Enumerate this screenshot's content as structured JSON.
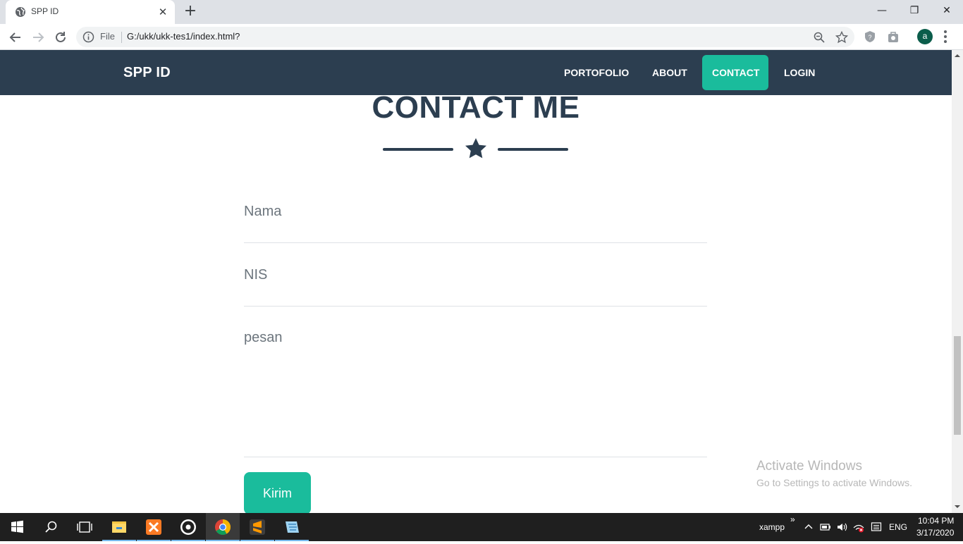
{
  "browser": {
    "tab_title": "SPP ID",
    "tab_close": "✕",
    "new_tab": "+",
    "window_controls": {
      "minimize": "—",
      "restore": "❐",
      "close": "✕"
    },
    "file_label": "File",
    "url": "G:/ukk/ukk-tes1/index.html?",
    "profile_initial": "a"
  },
  "site": {
    "brand": "SPP ID",
    "nav": [
      {
        "label": "PORTOFOLIO",
        "active": false
      },
      {
        "label": "ABOUT",
        "active": false
      },
      {
        "label": "CONTACT",
        "active": true
      },
      {
        "label": "LOGIN",
        "active": false
      }
    ],
    "heading": "CONTACT ME",
    "form": {
      "name_placeholder": "Nama",
      "nis_placeholder": "NIS",
      "message_placeholder": "pesan",
      "submit_label": "Kirim"
    },
    "colors": {
      "primary": "#2c3e50",
      "accent": "#1abc9c"
    }
  },
  "watermark": {
    "title": "Activate Windows",
    "subtitle": "Go to Settings to activate Windows."
  },
  "taskbar": {
    "tray_label": "xampp",
    "overflow": "»",
    "language": "ENG",
    "time": "10:04 PM",
    "date": "3/17/2020",
    "apps": [
      "start-icon",
      "search-icon",
      "task-view-icon",
      "file-explorer-icon",
      "xampp-icon",
      "obs-icon",
      "chrome-icon",
      "sublime-text-icon",
      "notepad-icon"
    ]
  }
}
